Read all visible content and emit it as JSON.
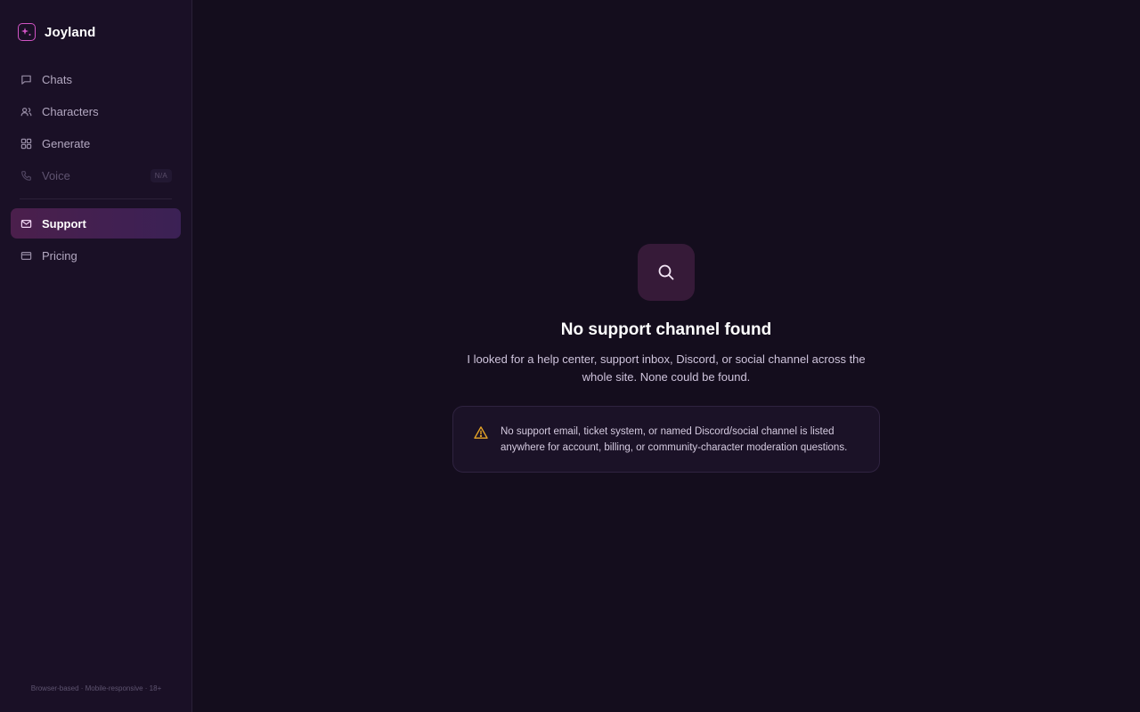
{
  "brand": {
    "name": "Joyland",
    "icon": "sparkle-icon"
  },
  "nav": {
    "items": [
      {
        "label": "Chats",
        "icon": "chat-bubble-icon"
      },
      {
        "label": "Characters",
        "icon": "users-icon"
      },
      {
        "label": "Generate",
        "icon": "grid-icon"
      },
      {
        "label": "Voice",
        "icon": "phone-icon",
        "badge": "N/A",
        "disabled": true
      },
      {
        "label": "Support",
        "icon": "mail-icon",
        "active": true
      },
      {
        "label": "Pricing",
        "icon": "credit-card-icon"
      }
    ]
  },
  "sidebar_footer": "Browser-based · Mobile-responsive · 18+",
  "main": {
    "empty_state": {
      "icon": "search-icon",
      "title": "No support channel found",
      "description": "I looked for a help center, support inbox, Discord, or social channel across the whole site. None could be found."
    },
    "notice": {
      "icon": "warning-icon",
      "text": "No support email, ticket system, or named Discord/social channel is listed anywhere for account, billing, or community-character moderation questions."
    }
  },
  "colors": {
    "accent": "#d154c4",
    "active_nav_start": "#4b1f4c",
    "active_nav_end": "#3b2155",
    "warning": "#e7a526",
    "background": "#140d1d",
    "sidebar": "#1a1026"
  }
}
